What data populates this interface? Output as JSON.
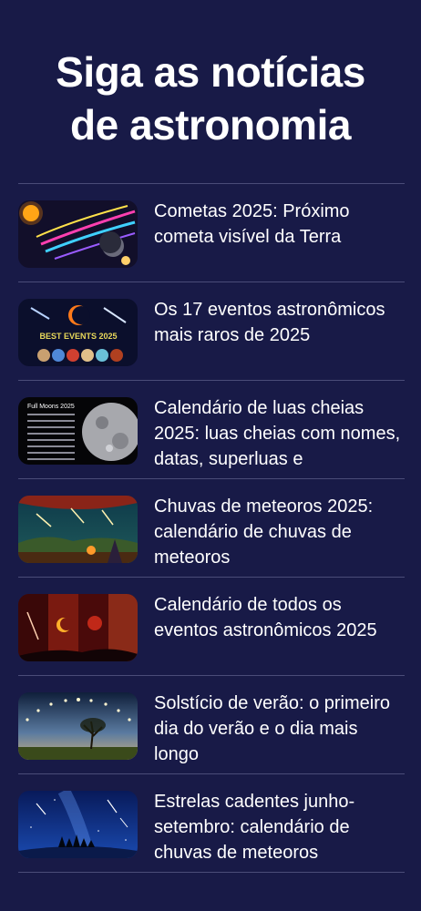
{
  "page": {
    "title_line1": "Siga as notícias",
    "title_line2": "de astronomia"
  },
  "articles": [
    {
      "headline": "Cometas 2025: Próximo cometa visível da Terra",
      "image": "comets-thumbnail"
    },
    {
      "headline": "Os 17 eventos astronômicos mais raros de 2025",
      "image": "rare-events-thumbnail",
      "image_caption": "BEST EVENTS 2025"
    },
    {
      "headline": "Calendário de luas cheias 2025: luas cheias com nomes, datas, superluas e",
      "image": "full-moons-thumbnail",
      "image_caption": "Full Moons 2025"
    },
    {
      "headline": "Chuvas de meteoros 2025: calendário de chuvas de meteoros",
      "image": "meteor-shower-thumbnail"
    },
    {
      "headline": "Calendário de todos os eventos astronômicos 2025",
      "image": "eclipse-thumbnail"
    },
    {
      "headline": "Solstício de verão: o primeiro dia do verão e o dia mais longo",
      "image": "solstice-thumbnail"
    },
    {
      "headline": "Estrelas cadentes junho-setembro: calendário de chuvas de meteoros",
      "image": "shooting-stars-thumbnail"
    }
  ],
  "colors": {
    "background": "#181a47",
    "divider": "#4a4c78",
    "text": "#ffffff"
  }
}
